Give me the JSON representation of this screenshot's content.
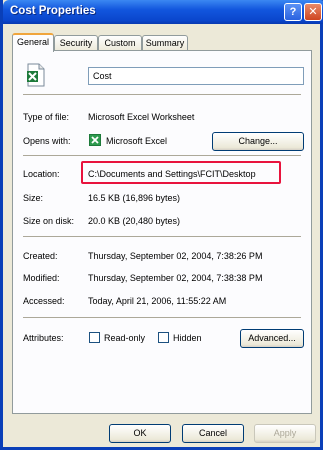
{
  "window": {
    "title": "Cost Properties",
    "help_label": "?",
    "close_label": "✕"
  },
  "tabs": [
    "General",
    "Security",
    "Custom",
    "Summary"
  ],
  "general": {
    "file_name": "Cost",
    "type_label": "Type of file:",
    "type_value": "Microsoft Excel Worksheet",
    "opens_label": "Opens with:",
    "opens_value": "Microsoft Excel",
    "change_button": "Change...",
    "location_label": "Location:",
    "location_value": "C:\\Documents and Settings\\FCIT\\Desktop",
    "size_label": "Size:",
    "size_value": "16.5 KB (16,896 bytes)",
    "size_disk_label": "Size on disk:",
    "size_disk_value": "20.0 KB (20,480 bytes)",
    "created_label": "Created:",
    "created_value": "Thursday, September 02, 2004, 7:38:26 PM",
    "modified_label": "Modified:",
    "modified_value": "Thursday, September 02, 2004, 7:38:38 PM",
    "accessed_label": "Accessed:",
    "accessed_value": "Today, April 21, 2006, 11:55:22 AM",
    "attributes_label": "Attributes:",
    "readonly_label": "Read-only",
    "hidden_label": "Hidden",
    "advanced_button": "Advanced..."
  },
  "footer": {
    "ok": "OK",
    "cancel": "Cancel",
    "apply": "Apply"
  },
  "colors": {
    "highlight": "#e8133d",
    "titlebar": "#0a46cc",
    "excel_green": "#1d7a3a"
  }
}
